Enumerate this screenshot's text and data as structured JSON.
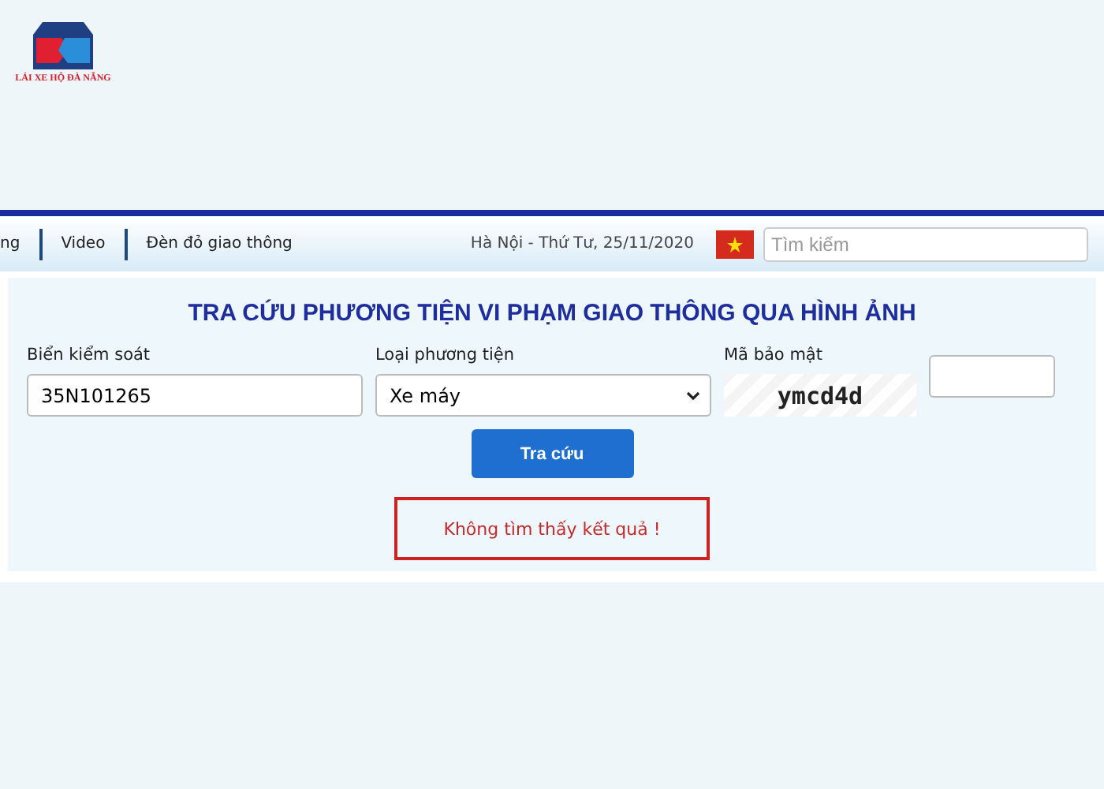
{
  "logo": {
    "brand": "LÁI XE HỘ ĐÀ NẴNG"
  },
  "nav": {
    "items": [
      {
        "label": "ng"
      },
      {
        "label": "Video"
      },
      {
        "label": "Đèn đỏ giao thông"
      }
    ],
    "date": "Hà Nội - Thứ Tư, 25/11/2020",
    "search": {
      "placeholder": "Tìm kiếm"
    }
  },
  "form": {
    "title": "TRA CỨU PHƯƠNG TIỆN VI PHẠM GIAO THÔNG QUA HÌNH ẢNH",
    "plate": {
      "label": "Biển kiểm soát",
      "value": "35N101265"
    },
    "vehicle": {
      "label": "Loại phương tiện",
      "value": "Xe máy"
    },
    "captcha": {
      "label": "Mã bảo mật",
      "code": "ymcd4d"
    },
    "button": "Tra cứu",
    "result": "Không tìm thấy kết quả !"
  }
}
